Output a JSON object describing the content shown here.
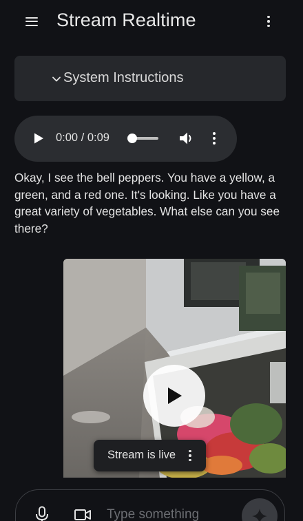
{
  "header": {
    "title": "Stream Realtime",
    "menu_icon": "hamburger-menu-icon",
    "more_icon": "more-vert-icon"
  },
  "system_instructions": {
    "label": "System Instructions",
    "expanded": false,
    "icon": "chevron-down-icon"
  },
  "audio_player": {
    "time_display": "0:00 / 0:09",
    "progress": 0.0,
    "icons": [
      "play-icon",
      "volume-icon",
      "more-vert-icon"
    ]
  },
  "response": {
    "text": "Okay, I see the bell peppers. You have a yellow, a green, and a red one. It's looking. Like you have a great variety of vegetables. What else can you see there?"
  },
  "video": {
    "chip_label": "Stream is live",
    "play_icon": "play-icon"
  },
  "input": {
    "placeholder": "Type something",
    "value": "",
    "icons": [
      "mic-icon",
      "videocam-icon",
      "sparkle-send-icon"
    ]
  },
  "colors": {
    "background": "#111216",
    "surface": "#26282c",
    "audio_surface": "#2b2d31",
    "text": "#e3e3e3",
    "placeholder": "#6c6e73"
  }
}
